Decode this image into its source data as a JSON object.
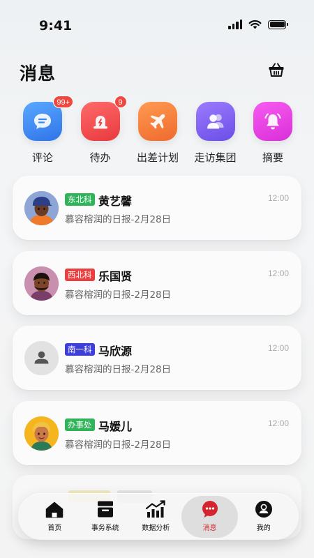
{
  "status_bar": {
    "time": "9:41"
  },
  "header": {
    "title": "消息"
  },
  "quick_actions": [
    {
      "label": "评论",
      "badge": "99+",
      "icon": "comment-bubble-icon",
      "color": "#3b86f0"
    },
    {
      "label": "待办",
      "badge": "9",
      "icon": "todo-alarm-icon",
      "color": "#f0484a"
    },
    {
      "label": "出差计划",
      "badge": "",
      "icon": "airplane-icon",
      "color": "#f57e3a"
    },
    {
      "label": "走访集团",
      "badge": "",
      "icon": "people-group-icon",
      "color": "#8061f0"
    },
    {
      "label": "摘要",
      "badge": "",
      "icon": "bell-icon",
      "color": "#e53de6"
    }
  ],
  "messages": [
    {
      "dept": "东北科",
      "dept_color": "#2fb45a",
      "name": "黄艺馨",
      "preview": "慕容榕润的日报-2月28日",
      "time": "12:00",
      "avatar": "avatar-cap-man"
    },
    {
      "dept": "西北科",
      "dept_color": "#e9403f",
      "name": "乐国贤",
      "preview": "慕容榕润的日报-2月28日",
      "time": "12:00",
      "avatar": "avatar-bearded-man"
    },
    {
      "dept": "南一科",
      "dept_color": "#3d3fd8",
      "name": "马欣源",
      "preview": "慕容榕润的日报-2月28日",
      "time": "12:00",
      "avatar": "default-user-icon"
    },
    {
      "dept": "办事处",
      "dept_color": "#2fb45a",
      "name": "马媛儿",
      "preview": "慕容榕润的日报-2月28日",
      "time": "12:00",
      "avatar": "avatar-blond-girl"
    }
  ],
  "bottom_nav": [
    {
      "label": "首页",
      "icon": "home-icon",
      "active": false
    },
    {
      "label": "事务系统",
      "icon": "inbox-tray-icon",
      "active": false
    },
    {
      "label": "数据分析",
      "icon": "chart-icon",
      "active": false
    },
    {
      "label": "消息",
      "icon": "message-dots-icon",
      "active": true
    },
    {
      "label": "我的",
      "icon": "profile-icon",
      "active": false
    }
  ]
}
